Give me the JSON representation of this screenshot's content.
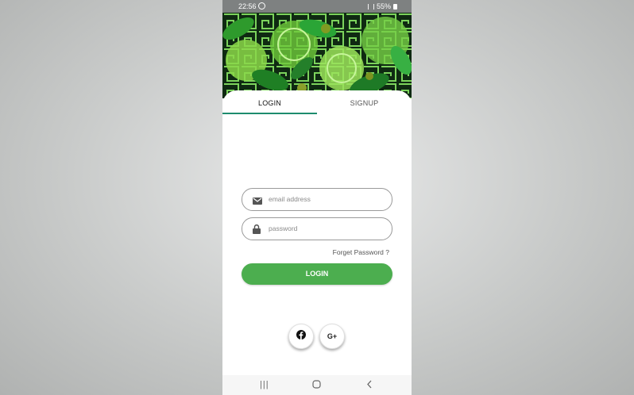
{
  "status_bar": {
    "time": "22:56",
    "battery": "55%"
  },
  "tabs": [
    {
      "label": "LOGIN",
      "selected": true
    },
    {
      "label": "SIGNUP",
      "selected": false
    }
  ],
  "login_form": {
    "email_placeholder": "email address",
    "password_placeholder": "password",
    "forgot_label": "Forget Password ?",
    "login_button": "LOGIN"
  },
  "social": {
    "facebook_icon": "facebook-icon",
    "google_label": "G+"
  },
  "colors": {
    "accent_green": "#4cae4f",
    "tab_indicator": "#1d8c6e",
    "status_bar": "#7e8181"
  },
  "nav": {
    "recents_icon": "recents-icon",
    "home_icon": "home-icon",
    "back_icon": "back-icon"
  }
}
